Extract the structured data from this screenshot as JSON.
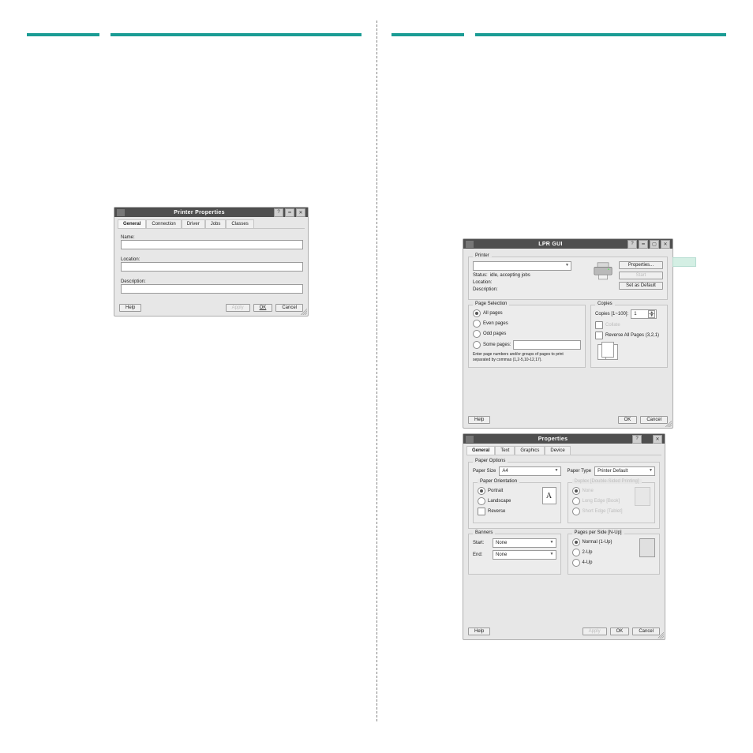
{
  "colors": {
    "teal": "#1a9c94",
    "mint": "#d4efe4",
    "dialog_title_bg": "#4f4f4f",
    "dialog_bg": "#e7e7e7"
  },
  "printerProperties": {
    "title": "Printer Properties",
    "tabs": [
      "General",
      "Connection",
      "Driver",
      "Jobs",
      "Classes"
    ],
    "activeTab": 0,
    "fields": {
      "name_label": "Name:",
      "name_value": "",
      "location_label": "Location:",
      "location_value": "",
      "description_label": "Description:",
      "description_value": ""
    },
    "buttons": {
      "help": "Help",
      "apply": "Apply",
      "ok": "OK",
      "cancel": "Cancel"
    },
    "ok_underline": "OK"
  },
  "lpr": {
    "title": "LPR GUI",
    "printer_section": {
      "legend": "Printer",
      "selected_printer": "",
      "status_label": "Status:",
      "status_value": "idle, accepting jobs",
      "location_label": "Location:",
      "location_value": "",
      "description_label": "Description:",
      "description_value": "",
      "properties_btn": "Properties...",
      "start_btn": "Start",
      "set_default_btn": "Set as Default"
    },
    "page_selection": {
      "legend": "Page Selection",
      "all_pages": "All pages",
      "even_pages": "Even pages",
      "odd_pages": "Odd pages",
      "some_pages": "Some pages:",
      "selected": "all",
      "range_value": "",
      "hint": "Enter page numbers and/or groups of pages to print separated by commas (1,2-5,10-12,17)."
    },
    "copies": {
      "legend": "Copies",
      "copies_label": "Copies [1~100]:",
      "copies_value": "1",
      "collate_label": "Collate",
      "reverse_label": "Reverse All Pages (3,2,1)"
    },
    "buttons": {
      "help": "Help",
      "ok": "OK",
      "cancel": "Cancel"
    }
  },
  "properties": {
    "title": "Properties",
    "tabs": [
      "General",
      "Text",
      "Graphics",
      "Device"
    ],
    "activeTab": 0,
    "paper_options": {
      "legend": "Paper Options",
      "paper_size_label": "Paper Size",
      "paper_size_value": "A4",
      "paper_type_label": "Paper Type",
      "paper_type_value": "Printer Default",
      "orientation": {
        "legend": "Paper Orientation",
        "portrait": "Portrait",
        "landscape": "Landscape",
        "selected": "portrait",
        "reverse": "Reverse",
        "sheet_glyph": "A"
      },
      "duplex": {
        "legend": "Duplex [Double-Sided Printing]",
        "none": "None",
        "long": "Long Edge [Book]",
        "short": "Short Edge [Tablet]",
        "selected": "none"
      }
    },
    "banners": {
      "legend": "Banners",
      "start_label": "Start:",
      "start_value": "None",
      "end_label": "End:",
      "end_value": "None"
    },
    "nup": {
      "legend": "Pages per Side [N-Up]",
      "one": "Normal (1-Up)",
      "two": "2-Up",
      "four": "4-Up",
      "selected": "one"
    },
    "buttons": {
      "help": "Help",
      "apply": "Apply",
      "ok": "OK",
      "cancel": "Cancel"
    }
  }
}
